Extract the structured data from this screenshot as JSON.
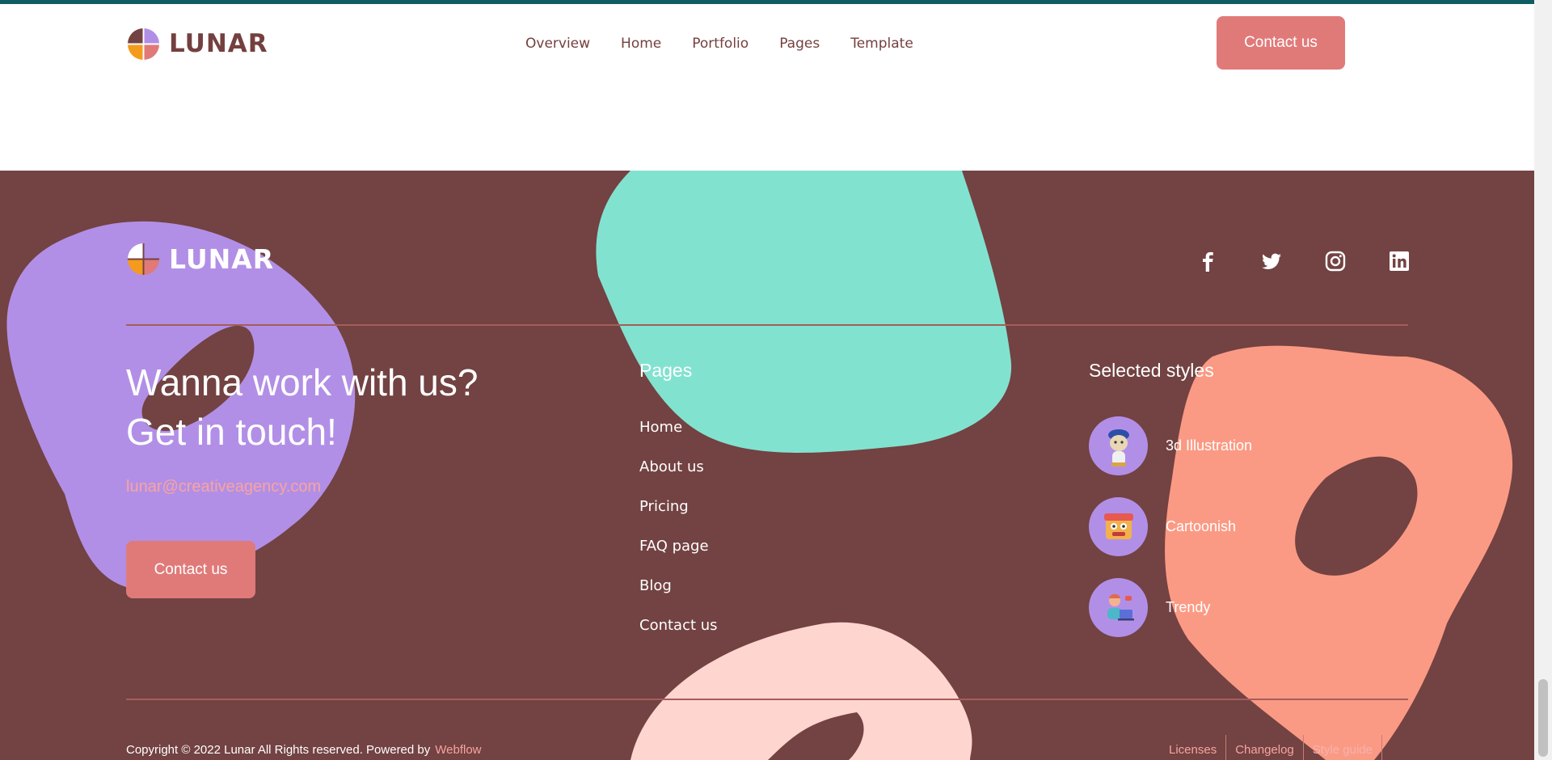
{
  "header": {
    "brand": "LUNAR",
    "nav": [
      "Overview",
      "Home",
      "Portfolio",
      "Pages",
      "Template"
    ],
    "cta": "Contact us"
  },
  "footer": {
    "brand": "LUNAR",
    "socials": [
      "facebook-icon",
      "twitter-icon",
      "instagram-icon",
      "linkedin-icon"
    ],
    "headline_1": "Wanna work with us?",
    "headline_2": "Get in touch!",
    "email": "lunar@creativeagency.com",
    "cta": "Contact us",
    "pages_title": "Pages",
    "pages": [
      "Home",
      "About us",
      "Pricing",
      "FAQ page",
      "Blog",
      "Contact us"
    ],
    "styles_title": "Selected styles",
    "styles": [
      "3d Illustration",
      "Cartoonish",
      "Trendy"
    ],
    "copyright": "Copyright © 2022 Lunar All Rights reserved. Powered by",
    "powered_by": "Webflow",
    "legal": [
      "Licenses",
      "Changelog",
      "Style guide"
    ]
  },
  "colors": {
    "brand_brown": "#734242",
    "accent_pink": "#e07a79",
    "teal_blob": "#82e2d0",
    "purple_blob": "#b28fe6",
    "salmon_blob": "#fb9a84",
    "light_pink_blob": "#ffd5cf"
  }
}
